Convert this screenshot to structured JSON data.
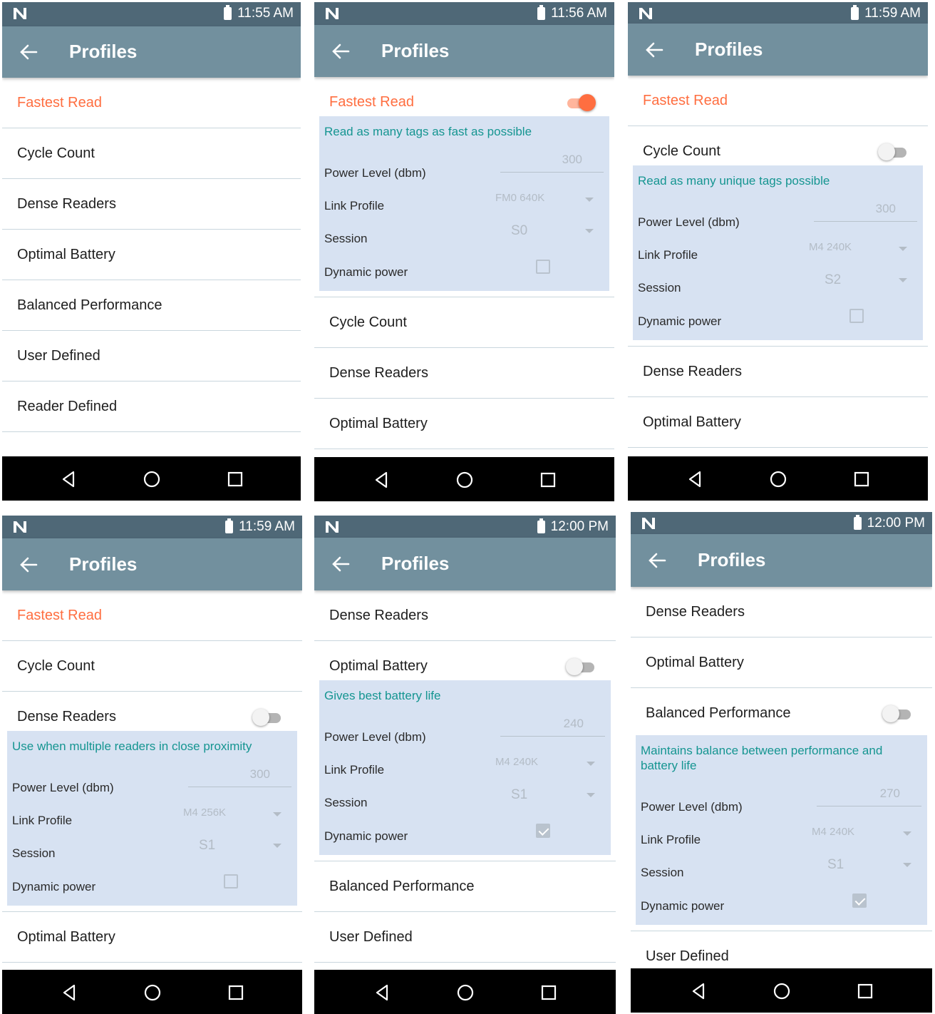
{
  "app_title": "Profiles",
  "screens": [
    {
      "time": "11:55 AM",
      "profiles": [
        "Fastest Read",
        "Cycle Count",
        "Dense Readers",
        "Optimal Battery",
        "Balanced Performance",
        "User Defined",
        "Reader Defined"
      ],
      "active": "Fastest Read",
      "expanded": null
    },
    {
      "time": "11:56 AM",
      "profiles": [
        "Fastest Read",
        "Cycle Count",
        "Dense Readers",
        "Optimal Battery"
      ],
      "active": "Fastest Read",
      "expanded": {
        "profile": "Fastest Read",
        "toggle_on": true,
        "description": "Read as many tags as fast as possible",
        "power_label": "Power Level (dbm)",
        "power_value": "300",
        "link_label": "Link Profile",
        "link_value": "FM0 640K",
        "session_label": "Session",
        "session_value": "S0",
        "dynamic_label": "Dynamic power",
        "dynamic_checked": false
      }
    },
    {
      "time": "11:59 AM",
      "profiles": [
        "Fastest Read",
        "Cycle Count",
        "Dense Readers",
        "Optimal Battery"
      ],
      "active": "Fastest Read",
      "expanded": {
        "profile": "Cycle Count",
        "toggle_on": false,
        "description": "Read as many unique tags possible",
        "power_label": "Power Level (dbm)",
        "power_value": "300",
        "link_label": "Link Profile",
        "link_value": "M4 240K",
        "session_label": "Session",
        "session_value": "S2",
        "dynamic_label": "Dynamic power",
        "dynamic_checked": false
      }
    },
    {
      "time": "11:59 AM",
      "profiles": [
        "Fastest Read",
        "Cycle Count",
        "Dense Readers",
        "Optimal Battery"
      ],
      "active": "Fastest Read",
      "expanded": {
        "profile": "Dense Readers",
        "toggle_on": false,
        "description": "Use when multiple readers in close proximity",
        "power_label": "Power Level (dbm)",
        "power_value": "300",
        "link_label": "Link Profile",
        "link_value": "M4 256K",
        "session_label": "Session",
        "session_value": "S1",
        "dynamic_label": "Dynamic power",
        "dynamic_checked": false
      }
    },
    {
      "time": "12:00 PM",
      "profiles": [
        "Dense Readers",
        "Optimal Battery",
        "Balanced Performance",
        "User Defined"
      ],
      "active": null,
      "expanded": {
        "profile": "Optimal Battery",
        "toggle_on": false,
        "description": "Gives best battery life",
        "power_label": "Power Level (dbm)",
        "power_value": "240",
        "link_label": "Link Profile",
        "link_value": "M4 240K",
        "session_label": "Session",
        "session_value": "S1",
        "dynamic_label": "Dynamic power",
        "dynamic_checked": true
      }
    },
    {
      "time": "12:00 PM",
      "profiles": [
        "Dense Readers",
        "Optimal Battery",
        "Balanced Performance",
        "User Defined"
      ],
      "active": null,
      "expanded": {
        "profile": "Balanced Performance",
        "toggle_on": false,
        "description": "Maintains balance between performance and battery life",
        "power_label": "Power Level (dbm)",
        "power_value": "270",
        "link_label": "Link Profile",
        "link_value": "M4 240K",
        "session_label": "Session",
        "session_value": "S1",
        "dynamic_label": "Dynamic power",
        "dynamic_checked": true
      }
    }
  ],
  "colors": {
    "status_bar": "#4f6877",
    "app_bar": "#72909e",
    "accent": "#ff6e40",
    "detail_bg": "#d7e2f2",
    "description": "#159591"
  },
  "icons": {
    "logo": "n-logo-icon",
    "battery": "battery-icon",
    "back": "back-arrow-icon",
    "nav_back": "nav-back-icon",
    "nav_home": "nav-home-icon",
    "nav_recents": "nav-recents-icon"
  }
}
